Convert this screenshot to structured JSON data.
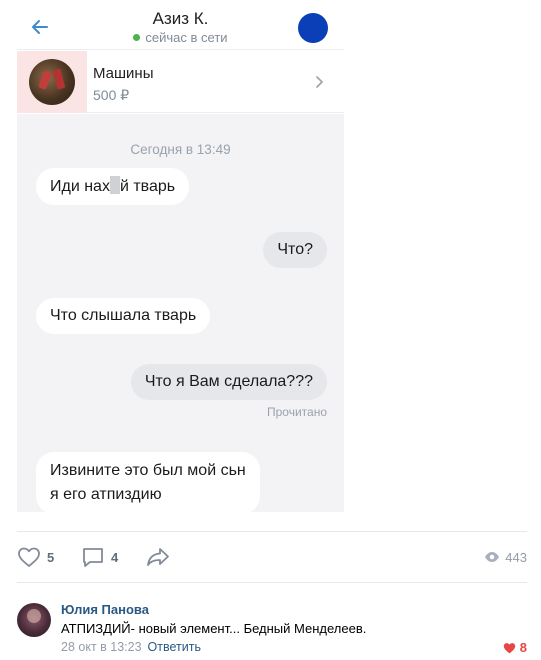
{
  "chat": {
    "contact_name": "Азиз К.",
    "status": "сейчас в сети",
    "avatar_color": "#0b3fb8",
    "online_color": "#4bb34b",
    "product": {
      "title": "Машины",
      "price": "500 ₽"
    },
    "date_separator": "Сегодня в 13:49",
    "messages": [
      {
        "direction": "in",
        "text_before": "Иди нах",
        "text_after": "й тварь"
      },
      {
        "direction": "out",
        "text": "Что?"
      },
      {
        "direction": "in",
        "text": "Что слышала тварь"
      },
      {
        "direction": "out",
        "text": "Что я Вам сделала???"
      },
      {
        "direction": "in",
        "line1": "Извините это был мой сьн",
        "line2": "я его атпиздию"
      }
    ],
    "read_status": "Прочитано"
  },
  "post": {
    "likes": "5",
    "comments": "4",
    "views": "443"
  },
  "comment": {
    "author": "Юлия Панова",
    "text": "АТПИЗДИЙ- новый элемент... Бедный Менделеев.",
    "time": "28 окт в 13:23",
    "reply_label": "Ответить",
    "likes": "8",
    "like_color": "#e64646"
  }
}
